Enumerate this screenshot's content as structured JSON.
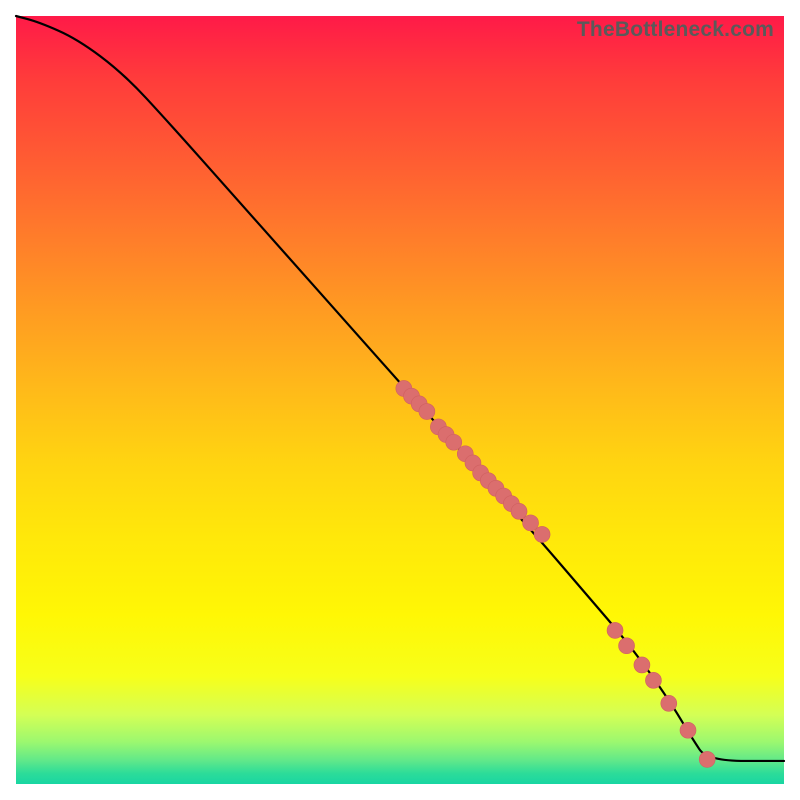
{
  "watermark": "TheBottleneck.com",
  "colors": {
    "point_fill": "#db6e6e",
    "curve_stroke": "#000000"
  },
  "chart_data": {
    "type": "line",
    "title": "",
    "xlabel": "",
    "ylabel": "",
    "xlim": [
      0,
      100
    ],
    "ylim": [
      0,
      100
    ],
    "grid": false,
    "legend": false,
    "series": [
      {
        "name": "curve",
        "x": [
          0,
          3,
          8,
          14,
          20,
          28,
          36,
          44,
          52,
          60,
          68,
          74,
          80,
          85,
          88,
          90,
          100
        ],
        "y": [
          100,
          99.2,
          97,
          92.5,
          86,
          77,
          68,
          59,
          50,
          41,
          32,
          25,
          18,
          11,
          6,
          3,
          3
        ]
      }
    ],
    "points": [
      {
        "x": 50.5,
        "y": 51.5
      },
      {
        "x": 51.5,
        "y": 50.5
      },
      {
        "x": 52.5,
        "y": 49.5
      },
      {
        "x": 53.5,
        "y": 48.5
      },
      {
        "x": 55.0,
        "y": 46.5
      },
      {
        "x": 56.0,
        "y": 45.5
      },
      {
        "x": 57.0,
        "y": 44.5
      },
      {
        "x": 58.5,
        "y": 43.0
      },
      {
        "x": 59.5,
        "y": 41.8
      },
      {
        "x": 60.5,
        "y": 40.5
      },
      {
        "x": 61.5,
        "y": 39.5
      },
      {
        "x": 62.5,
        "y": 38.5
      },
      {
        "x": 63.5,
        "y": 37.5
      },
      {
        "x": 64.5,
        "y": 36.5
      },
      {
        "x": 65.5,
        "y": 35.5
      },
      {
        "x": 67.0,
        "y": 34.0
      },
      {
        "x": 68.5,
        "y": 32.5
      },
      {
        "x": 78.0,
        "y": 20.0
      },
      {
        "x": 79.5,
        "y": 18.0
      },
      {
        "x": 81.5,
        "y": 15.5
      },
      {
        "x": 83.0,
        "y": 13.5
      },
      {
        "x": 85.0,
        "y": 10.5
      },
      {
        "x": 87.5,
        "y": 7.0
      },
      {
        "x": 90.0,
        "y": 3.2
      }
    ],
    "point_radius": 8
  }
}
